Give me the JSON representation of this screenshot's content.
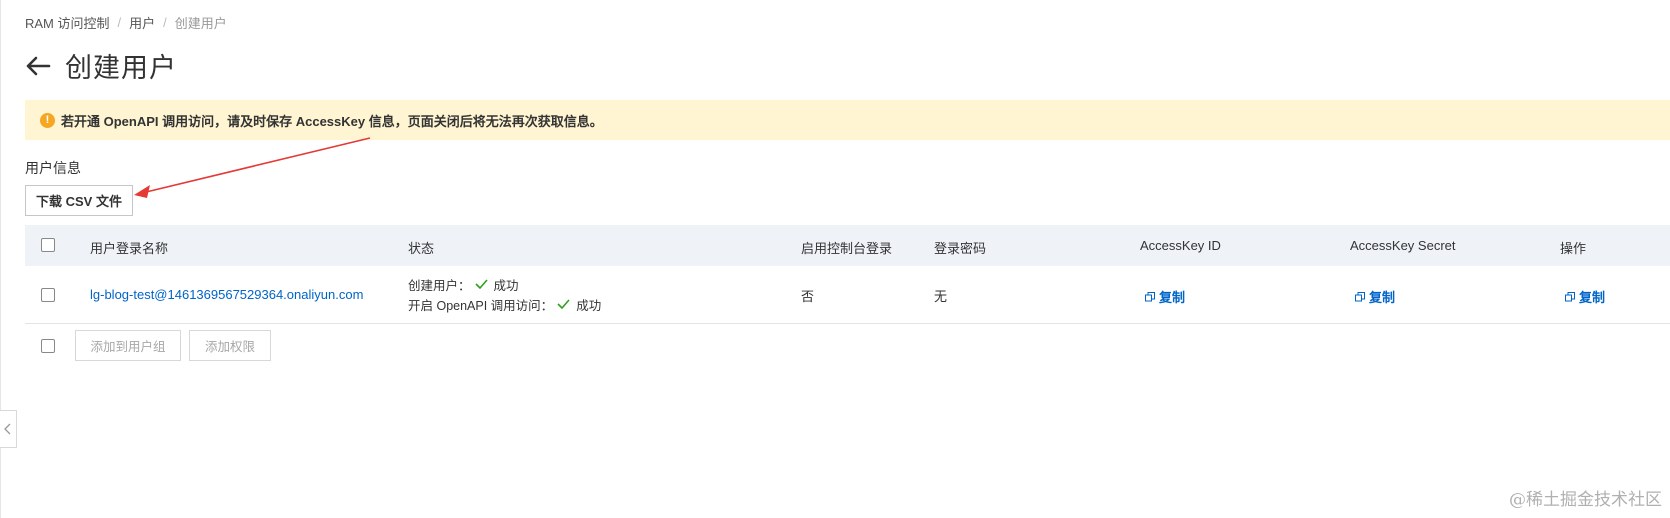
{
  "breadcrumb": [
    "RAM 访问控制",
    "用户",
    "创建用户"
  ],
  "page_title": "创建用户",
  "warning": "若开通 OpenAPI 调用访问，请及时保存 AccessKey 信息，页面关闭后将无法再次获取信息。",
  "section_label": "用户信息",
  "csv_button": "下载 CSV 文件",
  "table": {
    "headers": {
      "login_name": "用户登录名称",
      "status": "状态",
      "console_login": "启用控制台登录",
      "password": "登录密码",
      "ak_id": "AccessKey ID",
      "ak_secret": "AccessKey Secret",
      "action": "操作"
    },
    "row": {
      "login_name": "lg-blog-test@1461369567529364.onaliyun.com",
      "status_create_label": "创建用户：",
      "status_create_value": "成功",
      "status_api_label": "开启 OpenAPI 调用访问：",
      "status_api_value": "成功",
      "console_login": "否",
      "password": "无",
      "ak_id_copy": "复制",
      "ak_secret_copy": "复制",
      "action_copy": "复制"
    }
  },
  "footer": {
    "add_group": "添加到用户组",
    "add_permission": "添加权限"
  },
  "watermark": "@稀土掘金技术社区",
  "colors": {
    "link": "#0064c8",
    "warning_bg": "#fff5d3",
    "warning_icon": "#f5a623",
    "success": "#2ea121",
    "annotation_arrow": "#e53935"
  },
  "icons": {
    "back": "arrow-left-icon",
    "warning": "exclamation-circle-icon",
    "check": "check-icon",
    "copy": "copy-icon",
    "collapse": "chevron-left-icon"
  }
}
